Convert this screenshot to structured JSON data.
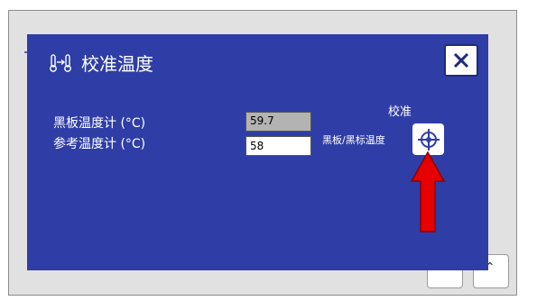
{
  "dialog": {
    "title": "校准温度",
    "close_icon": "close-icon",
    "title_icon": "thermometer-pair-icon"
  },
  "fields": {
    "blackboard_label": "黑板温度计 (°C)",
    "blackboard_value": "59.7",
    "reference_label": "参考温度计 (°C)",
    "reference_value": "58"
  },
  "calibrate": {
    "heading": "校准",
    "label": "黑板/黑标温度",
    "icon": "crosshair-target-icon"
  },
  "colors": {
    "dialog_bg": "#2f3ea6",
    "annotation_arrow": "#e60000"
  }
}
